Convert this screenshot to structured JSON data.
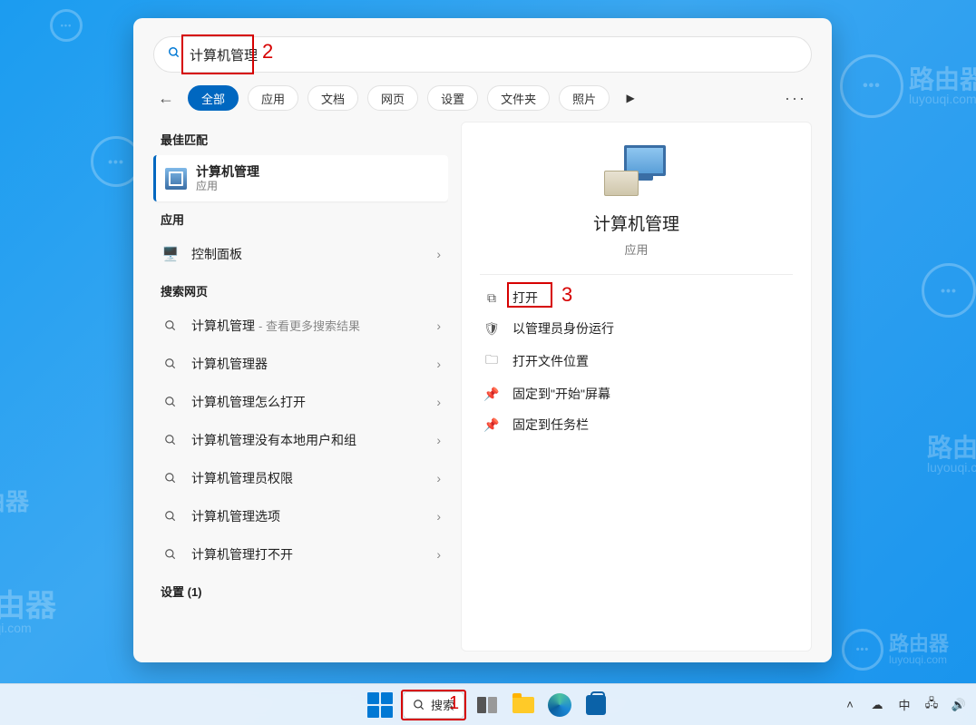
{
  "watermark": {
    "cn": "路由器",
    "en": "luyouqi.com"
  },
  "annotations": {
    "n1": "1",
    "n2": "2",
    "n3": "3"
  },
  "search": {
    "value": "计算机管理",
    "filters": {
      "all": "全部",
      "apps": "应用",
      "docs": "文档",
      "web": "网页",
      "settings": "设置",
      "folders": "文件夹",
      "photos": "照片"
    }
  },
  "left": {
    "best_label": "最佳匹配",
    "best": {
      "title": "计算机管理",
      "sub": "应用"
    },
    "apps_label": "应用",
    "control_panel": "控制面板",
    "web_label": "搜索网页",
    "web_items": {
      "i0": {
        "t": "计算机管理",
        "sfx": "- 查看更多搜索结果"
      },
      "i1": {
        "t": "计算机管理器"
      },
      "i2": {
        "t": "计算机管理怎么打开"
      },
      "i3": {
        "t": "计算机管理没有本地用户和组"
      },
      "i4": {
        "t": "计算机管理员权限"
      },
      "i5": {
        "t": "计算机管理选项"
      },
      "i6": {
        "t": "计算机管理打不开"
      }
    },
    "settings_label": "设置 (1)"
  },
  "right": {
    "title": "计算机管理",
    "sub": "应用",
    "actions": {
      "open": "打开",
      "admin": "以管理员身份运行",
      "loc": "打开文件位置",
      "pin_start": "固定到\"开始\"屏幕",
      "pin_task": "固定到任务栏"
    }
  },
  "taskbar": {
    "search": "搜索",
    "ime": "中"
  }
}
